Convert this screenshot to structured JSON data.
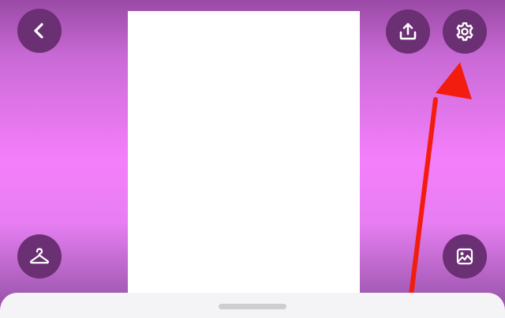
{
  "screen": {
    "title": "",
    "accent_color": "#6b2f74",
    "background_gradient": [
      "#9a4aa6",
      "#f57ffb",
      "#8f4aa0"
    ]
  },
  "toolbar": {
    "back_icon": "chevron-left-icon",
    "share_icon": "upload-icon",
    "settings_icon": "gear-icon"
  },
  "side_controls": {
    "outfit_icon": "hanger-icon",
    "image_icon": "image-icon"
  },
  "annotation": {
    "arrow_color": "#f21d0f",
    "points_to": "settings-button"
  }
}
